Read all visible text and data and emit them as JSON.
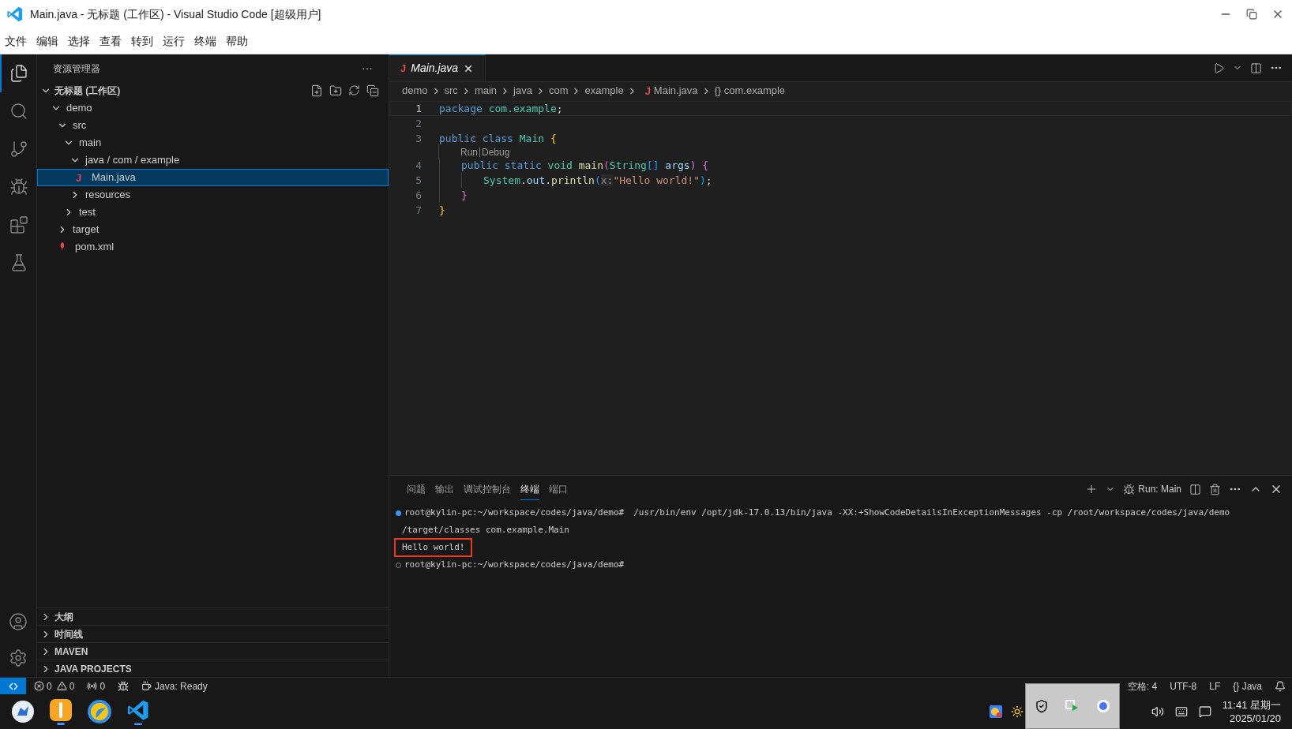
{
  "window": {
    "title": "Main.java - 无标题 (工作区) - Visual Studio Code [超级用户]"
  },
  "menu": [
    "文件",
    "编辑",
    "选择",
    "查看",
    "转到",
    "运行",
    "终端",
    "帮助"
  ],
  "activity_bar": [
    {
      "kind": "files",
      "selected": true
    },
    {
      "kind": "search",
      "selected": false
    },
    {
      "kind": "git",
      "selected": false
    },
    {
      "kind": "debug",
      "selected": false
    },
    {
      "kind": "extensions",
      "selected": false
    },
    {
      "kind": "testing",
      "selected": false
    }
  ],
  "explorer": {
    "title": "资源管理器",
    "more": "···",
    "workspace": {
      "label": "无标题 (工作区)",
      "expanded": true
    },
    "tree": [
      {
        "label": "demo",
        "kind": "folder",
        "expanded": true,
        "selected": false,
        "children": [
          {
            "label": "src",
            "kind": "folder",
            "expanded": true,
            "selected": false,
            "children": [
              {
                "label": "main",
                "kind": "folder",
                "expanded": true,
                "selected": false,
                "children": [
                  {
                    "label": "java / com / example",
                    "kind": "folder",
                    "expanded": true,
                    "selected": false,
                    "children": [
                      {
                        "label": "Main.java",
                        "kind": "java",
                        "icon": "J",
                        "selected": true
                      }
                    ]
                  },
                  {
                    "label": "resources",
                    "kind": "folder",
                    "expanded": false,
                    "selected": false
                  }
                ]
              },
              {
                "label": "test",
                "kind": "folder",
                "expanded": false,
                "selected": false
              }
            ]
          },
          {
            "label": "target",
            "kind": "folder",
            "expanded": false,
            "selected": false
          },
          {
            "label": "pom.xml",
            "kind": "xml",
            "selected": false
          }
        ]
      }
    ],
    "sections": [
      {
        "label": "大纲",
        "expanded": false
      },
      {
        "label": "时间线",
        "expanded": false
      },
      {
        "label": "MAVEN",
        "expanded": false
      },
      {
        "label": "JAVA PROJECTS",
        "expanded": false
      }
    ]
  },
  "editor": {
    "tabs": [
      {
        "label": "Main.java",
        "icon": "J",
        "selected": true
      }
    ],
    "breadcrumb": [
      {
        "label": "demo"
      },
      {
        "label": "src"
      },
      {
        "label": "main"
      },
      {
        "label": "java"
      },
      {
        "label": "com"
      },
      {
        "label": "example"
      },
      {
        "label": "Main.java",
        "icon": "J"
      },
      {
        "label": "{} com.example"
      }
    ],
    "lines": [
      {
        "kind": "code",
        "number": "1",
        "current": true,
        "tokens": [
          {
            "text": "package ",
            "kind": "keyword"
          },
          {
            "text": "com.example",
            "kind": "type"
          },
          {
            "text": ";",
            "kind": "plain"
          }
        ]
      },
      {
        "kind": "code",
        "number": "2",
        "current": false
      },
      {
        "kind": "code",
        "number": "3",
        "current": false,
        "tokens": [
          {
            "text": "public class ",
            "kind": "keyword"
          },
          {
            "text": "Main ",
            "kind": "type"
          },
          {
            "text": "{",
            "kind": "bracket1"
          }
        ],
        "children": [
          {
            "kind": "codelens",
            "links": [
              "Run",
              "Debug"
            ]
          },
          {
            "kind": "code",
            "number": "4",
            "current": false,
            "tokens": [
              {
                "text": "public static ",
                "kind": "keyword"
              },
              {
                "text": "void ",
                "kind": "type"
              },
              {
                "text": "main",
                "kind": "func"
              },
              {
                "text": "(",
                "kind": "bracket2"
              },
              {
                "text": "String",
                "kind": "type"
              },
              {
                "text": "[]",
                "kind": "bracket3"
              },
              {
                "text": " args",
                "kind": "var"
              },
              {
                "text": ") ",
                "kind": "bracket2"
              },
              {
                "text": "{",
                "kind": "bracket2"
              }
            ],
            "children": [
              {
                "kind": "code",
                "number": "5",
                "current": false,
                "tokens": [
                  {
                    "text": "System",
                    "kind": "type"
                  },
                  {
                    "text": ".",
                    "kind": "plain"
                  },
                  {
                    "text": "out",
                    "kind": "var"
                  },
                  {
                    "text": ".",
                    "kind": "plain"
                  },
                  {
                    "text": "println",
                    "kind": "func"
                  },
                  {
                    "text": "(",
                    "kind": "bracket3"
                  },
                  {
                    "text": "x:",
                    "kind": "hint"
                  },
                  {
                    "text": "\"Hello world!\"",
                    "kind": "string"
                  },
                  {
                    "text": ")",
                    "kind": "bracket3"
                  },
                  {
                    "text": ";",
                    "kind": "plain"
                  }
                ]
              }
            ]
          },
          {
            "kind": "code",
            "number": "6",
            "current": false,
            "tokens": [
              {
                "text": "}",
                "kind": "bracket2"
              }
            ]
          }
        ]
      },
      {
        "kind": "code",
        "number": "7",
        "current": false,
        "tokens": [
          {
            "text": "}",
            "kind": "bracket1"
          }
        ]
      }
    ]
  },
  "panel": {
    "tabs": [
      {
        "label": "问题",
        "selected": false
      },
      {
        "label": "输出",
        "selected": false
      },
      {
        "label": "调试控制台",
        "selected": false
      },
      {
        "label": "终端",
        "selected": true
      },
      {
        "label": "端口",
        "selected": false
      }
    ],
    "run_label": "Run: Main",
    "terminal": [
      {
        "kind": "prompt",
        "succeeded": true,
        "prompt": "root@kylin-pc:~/workspace/codes/java/demo#",
        "command": "/usr/bin/env /opt/jdk-17.0.13/bin/java -XX:+ShowCodeDetailsInExceptionMessages -cp /root/workspace/codes/java/demo"
      },
      {
        "kind": "output",
        "text": "/target/classes com.example.Main",
        "highlighted": false
      },
      {
        "kind": "output",
        "text": "Hello world!",
        "highlighted": true
      },
      {
        "kind": "prompt",
        "succeeded": false,
        "prompt": "root@kylin-pc:~/workspace/codes/java/demo#"
      }
    ]
  },
  "status_bar": {
    "errors": "0",
    "warnings": "0",
    "ports": "0",
    "java": "Java: Ready",
    "right": [
      "空格: 4",
      "UTF-8",
      "LF",
      "{} Java"
    ]
  },
  "taskbar": {
    "clock": "11:41 星期一",
    "date": "2025/01/20"
  }
}
